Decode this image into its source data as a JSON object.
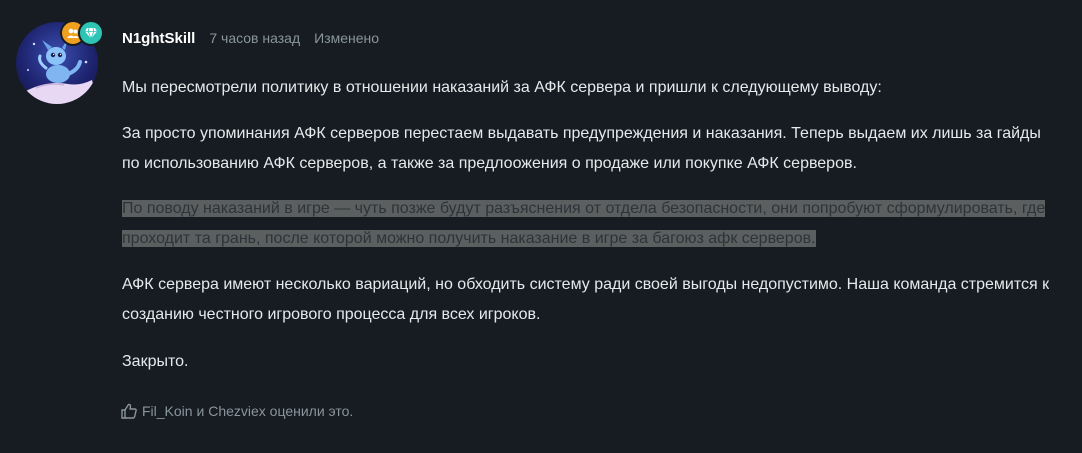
{
  "author": {
    "username": "N1ghtSkill",
    "time": "7 часов назад",
    "edited": "Изменено",
    "avatar_icon": "dragon-avatar-icon",
    "badges": [
      {
        "icon": "group-icon",
        "color": "#f0a020"
      },
      {
        "icon": "diamond-icon",
        "color": "#2ec4b6"
      }
    ]
  },
  "post": {
    "paragraphs": [
      "Мы пересмотрели политику в отношении наказаний за АФК сервера и пришли к следующему выводу:",
      "За просто упоминания АФК серверов перестаем выдавать предупреждения и наказания. Теперь выдаем их лишь за гайды по использованию АФК серверов, а также за предлоожения о продаже или покупке АФК серверов.",
      "По поводу наказаний в игре — чуть позже будут разъяснения от отдела безопасности, они попробуют сформулировать, где проходит та грань, после которой можно получить наказание в игре за багоюз афк серверов.",
      "АФК сервера имеют несколько вариаций, но обходить систему ради своей выгоды недопустимо. Наша команда стремится к созданию честного игрового процесса для всех игроков.",
      "Закрыто."
    ]
  },
  "reactions": {
    "icon": "thumbs-up-icon",
    "user1": "Fil_Koin",
    "conjunction": " и ",
    "user2": "Chezviex",
    "suffix": " оценили это."
  },
  "colors": {
    "background": "#161c21",
    "text": "#e6e9eb",
    "muted": "#8a959e",
    "highlight_bg": "#5b5f60"
  }
}
